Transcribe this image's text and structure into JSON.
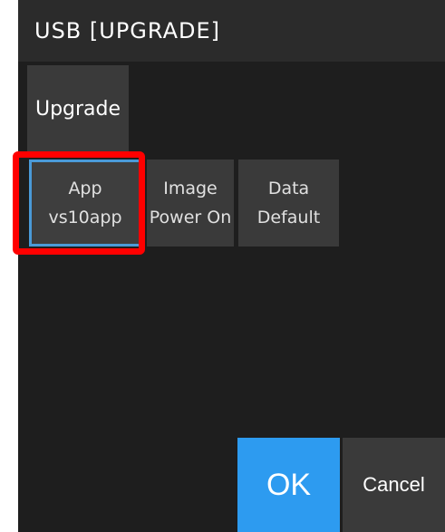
{
  "header": {
    "title": "USB [UPGRADE]"
  },
  "tabs": [
    {
      "label": "Upgrade"
    }
  ],
  "tiles": [
    {
      "line1": "App",
      "line2": "vs10app"
    },
    {
      "line1": "Image",
      "line2": "Power On"
    },
    {
      "line1": "Data",
      "line2": "Default"
    }
  ],
  "buttons": {
    "ok_label": "OK",
    "cancel_label": "Cancel"
  },
  "colors": {
    "ok_button": "#2d9bf0",
    "highlight": "#ff0000",
    "selection_border": "#4a9ad8",
    "background": "#1e1e1e"
  }
}
